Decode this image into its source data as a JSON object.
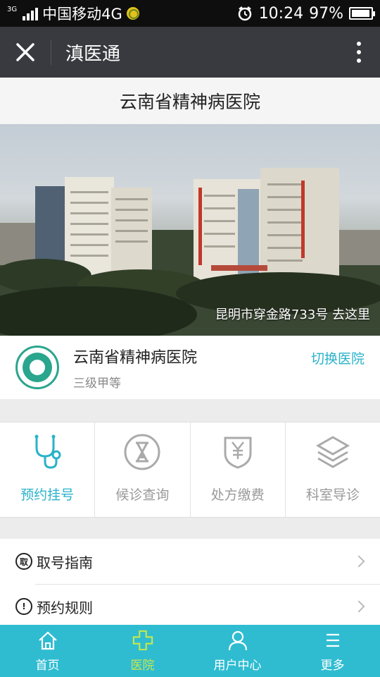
{
  "status_bar": {
    "carrier": "中国移动4G",
    "time": "10:24",
    "battery": "97%"
  },
  "nav": {
    "title": "滇医通"
  },
  "page": {
    "title": "云南省精神病医院"
  },
  "banner": {
    "address": "昆明市穿金路733号 去这里"
  },
  "hospital": {
    "name": "云南省精神病医院",
    "level": "三级甲等",
    "switch_label": "切换医院"
  },
  "functions": [
    {
      "label": "预约挂号",
      "icon": "stethoscope-icon",
      "active": true
    },
    {
      "label": "候诊查询",
      "icon": "hourglass-icon",
      "active": false
    },
    {
      "label": "处方缴费",
      "icon": "yen-shield-icon",
      "active": false
    },
    {
      "label": "科室导诊",
      "icon": "layers-icon",
      "active": false
    }
  ],
  "list": [
    {
      "label": "取号指南",
      "icon_text": "取"
    },
    {
      "label": "预约规则",
      "icon_text": "!"
    }
  ],
  "tabs": [
    {
      "label": "首页",
      "icon": "home-icon",
      "active": false
    },
    {
      "label": "医院",
      "icon": "hospital-cross-icon",
      "active": true
    },
    {
      "label": "用户中心",
      "icon": "user-icon",
      "active": false
    },
    {
      "label": "更多",
      "icon": "menu-icon",
      "active": false
    }
  ],
  "colors": {
    "accent": "#29b2c9",
    "tabbar": "#2fbcd1",
    "tab_active": "#c8e84a",
    "navbar": "#393a3f"
  }
}
